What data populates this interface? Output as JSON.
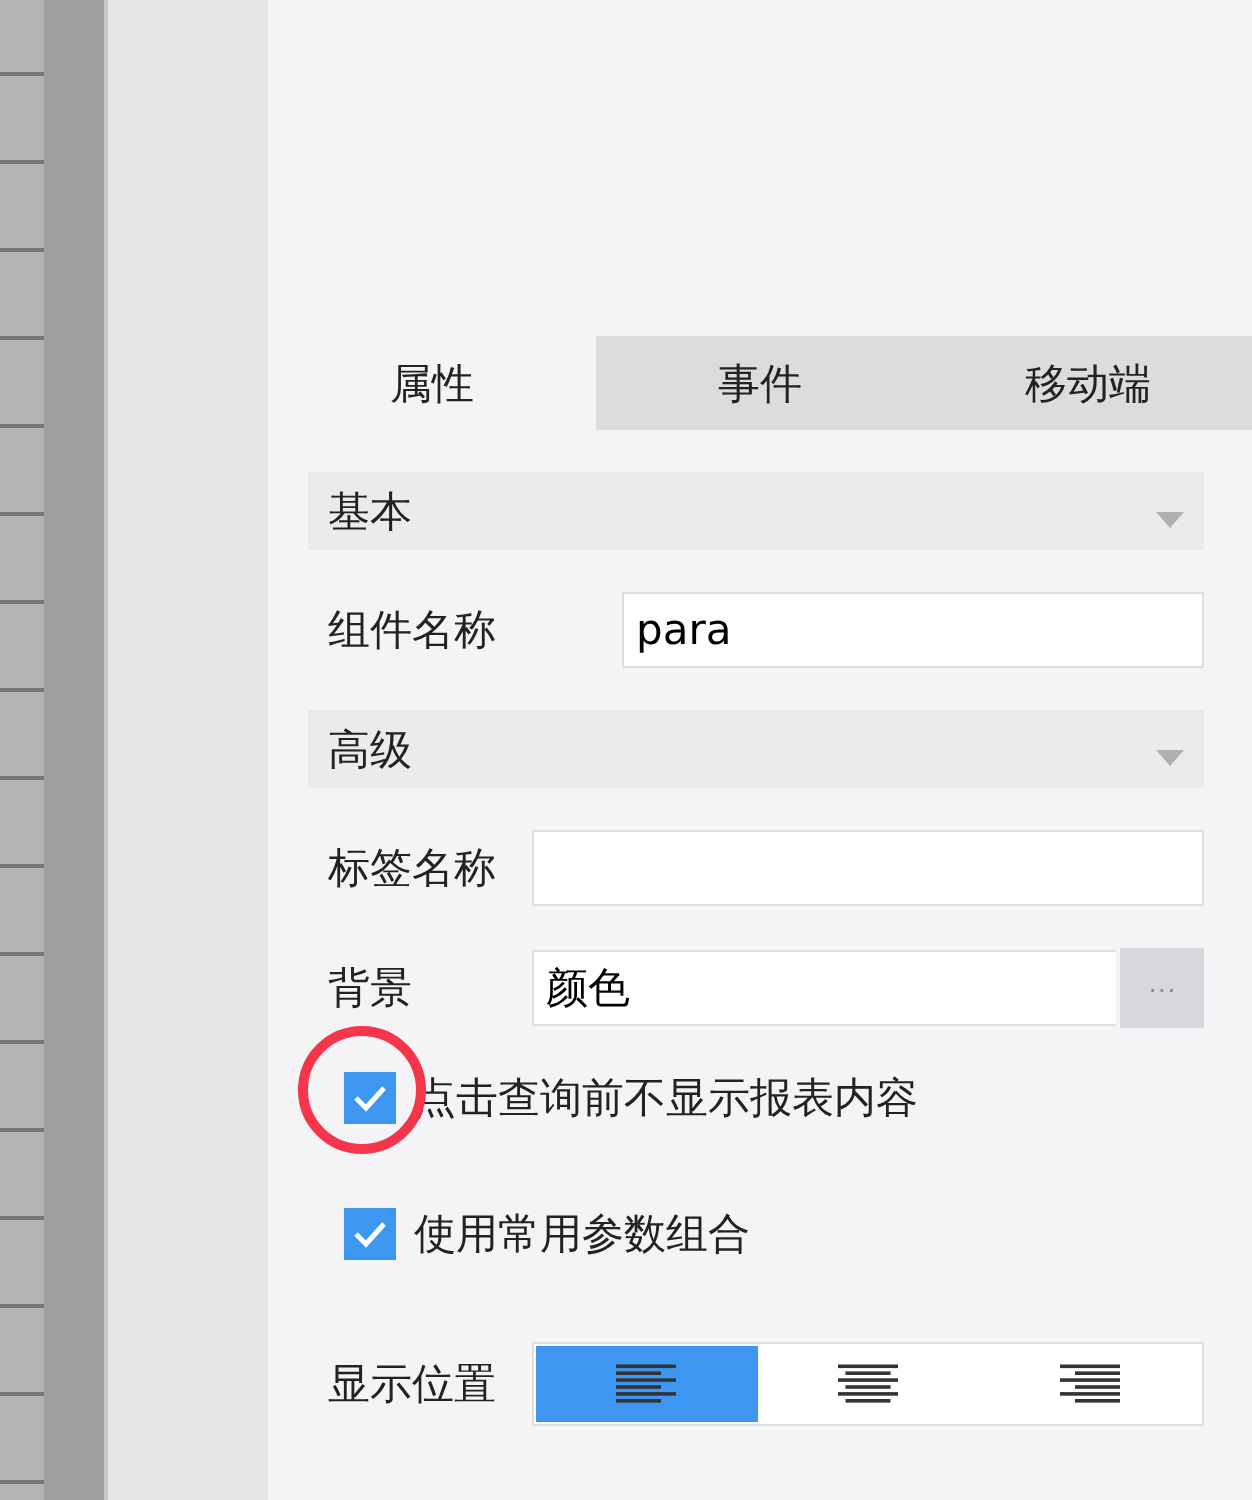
{
  "tabs": [
    {
      "label": "属性",
      "selected": true
    },
    {
      "label": "事件",
      "selected": false
    },
    {
      "label": "移动端",
      "selected": false
    }
  ],
  "sections": [
    {
      "title": "基本",
      "expanded": true,
      "rows": [
        {
          "kind": "input",
          "label": "组件名称",
          "value": "para"
        }
      ]
    },
    {
      "title": "高级",
      "expanded": true,
      "rows": [
        {
          "kind": "input",
          "label": "标签名称",
          "value": ""
        },
        {
          "kind": "picker",
          "label": "背景",
          "value": "颜色",
          "button": "···"
        },
        {
          "kind": "checkbox",
          "label": "点击查询前不显示报表内容",
          "checked": true,
          "highlighted": true
        },
        {
          "kind": "checkbox",
          "label": "使用常用参数组合",
          "checked": true,
          "highlighted": false
        },
        {
          "kind": "align",
          "label": "显示位置",
          "options": [
            {
              "kind": "left",
              "selected": true
            },
            {
              "kind": "center",
              "selected": false
            },
            {
              "kind": "right",
              "selected": false
            }
          ]
        }
      ]
    }
  ]
}
